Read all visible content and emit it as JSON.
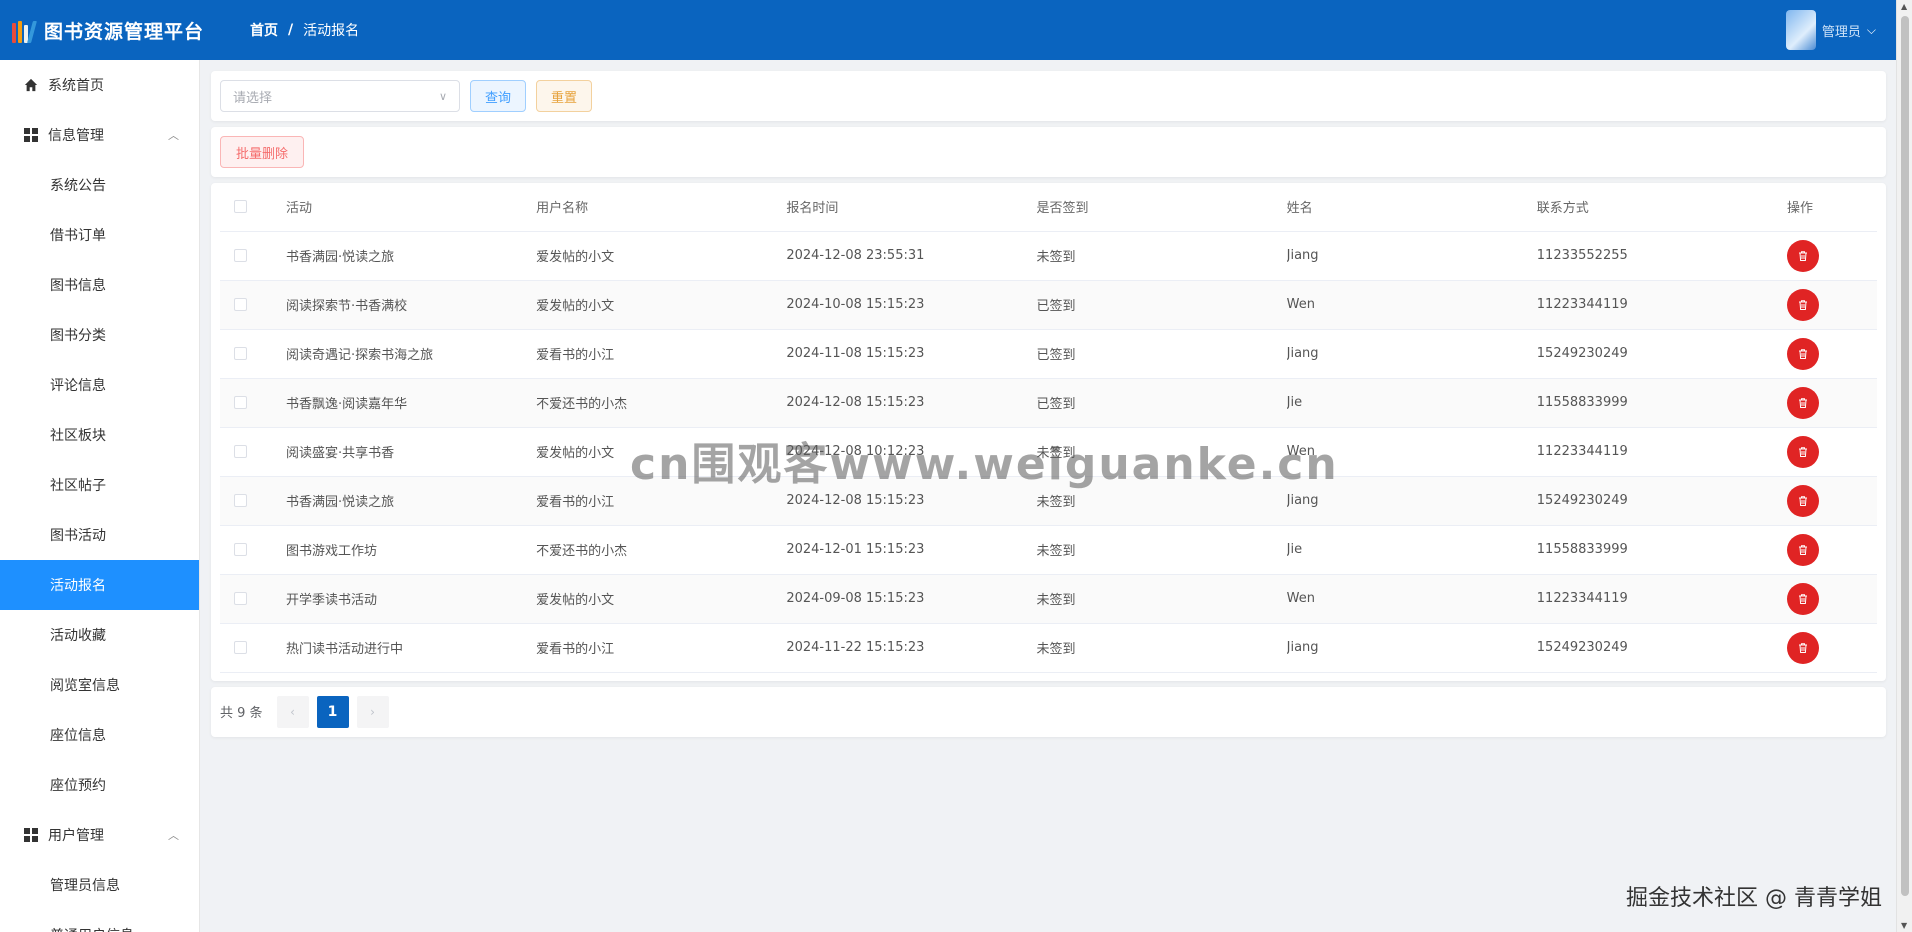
{
  "app": {
    "title": "图书资源管理平台",
    "logo_colors": [
      "#e74c3c",
      "#f39c12",
      "#ecf0f1",
      "#3498db"
    ]
  },
  "breadcrumb": {
    "home": "首页",
    "separator": "/",
    "current": "活动报名"
  },
  "user": {
    "name": "管理员"
  },
  "sidebar": {
    "items": [
      {
        "label": "系统首页",
        "type": "top",
        "icon": "home-icon"
      },
      {
        "label": "信息管理",
        "type": "group",
        "icon": "grid-icon"
      },
      {
        "label": "系统公告",
        "type": "sub"
      },
      {
        "label": "借书订单",
        "type": "sub"
      },
      {
        "label": "图书信息",
        "type": "sub"
      },
      {
        "label": "图书分类",
        "type": "sub"
      },
      {
        "label": "评论信息",
        "type": "sub"
      },
      {
        "label": "社区板块",
        "type": "sub"
      },
      {
        "label": "社区帖子",
        "type": "sub"
      },
      {
        "label": "图书活动",
        "type": "sub"
      },
      {
        "label": "活动报名",
        "type": "sub",
        "active": true
      },
      {
        "label": "活动收藏",
        "type": "sub"
      },
      {
        "label": "阅览室信息",
        "type": "sub"
      },
      {
        "label": "座位信息",
        "type": "sub"
      },
      {
        "label": "座位预约",
        "type": "sub"
      },
      {
        "label": "用户管理",
        "type": "group",
        "icon": "grid-icon"
      },
      {
        "label": "管理员信息",
        "type": "sub"
      },
      {
        "label": "普通用户信息",
        "type": "sub"
      }
    ]
  },
  "search": {
    "placeholder": "请选择",
    "query_label": "查询",
    "reset_label": "重置"
  },
  "actions": {
    "batch_delete_label": "批量删除"
  },
  "table": {
    "columns": [
      "活动",
      "用户名称",
      "报名时间",
      "是否签到",
      "姓名",
      "联系方式",
      "操作"
    ],
    "rows": [
      [
        "书香满园·悦读之旅",
        "爱发帖的小文",
        "2024-12-08 23:55:31",
        "未签到",
        "Jiang",
        "11233552255"
      ],
      [
        "阅读探索节·书香满校",
        "爱发帖的小文",
        "2024-10-08 15:15:23",
        "已签到",
        "Wen",
        "11223344119"
      ],
      [
        "阅读奇遇记·探索书海之旅",
        "爱看书的小江",
        "2024-11-08 15:15:23",
        "已签到",
        "Jiang",
        "15249230249"
      ],
      [
        "书香飘逸·阅读嘉年华",
        "不爱还书的小杰",
        "2024-12-08 15:15:23",
        "已签到",
        "Jie",
        "11558833999"
      ],
      [
        "阅读盛宴·共享书香",
        "爱发帖的小文",
        "2024-12-08 10:12:23",
        "未签到",
        "Wen",
        "11223344119"
      ],
      [
        "书香满园·悦读之旅",
        "爱看书的小江",
        "2024-12-08 15:15:23",
        "未签到",
        "Jiang",
        "15249230249"
      ],
      [
        "图书游戏工作坊",
        "不爱还书的小杰",
        "2024-12-01 15:15:23",
        "未签到",
        "Jie",
        "11558833999"
      ],
      [
        "开学季读书活动",
        "爱发帖的小文",
        "2024-09-08 15:15:23",
        "未签到",
        "Wen",
        "11223344119"
      ],
      [
        "热门读书活动进行中",
        "爱看书的小江",
        "2024-11-22 15:15:23",
        "未签到",
        "Jiang",
        "15249230249"
      ]
    ]
  },
  "pagination": {
    "total_label": "共 9 条",
    "current_page": "1",
    "prev": "‹",
    "next": "›"
  },
  "watermark": "cn围观客www.weiguanke.cn",
  "credit": "掘金技术社区 @ 青青学姐"
}
